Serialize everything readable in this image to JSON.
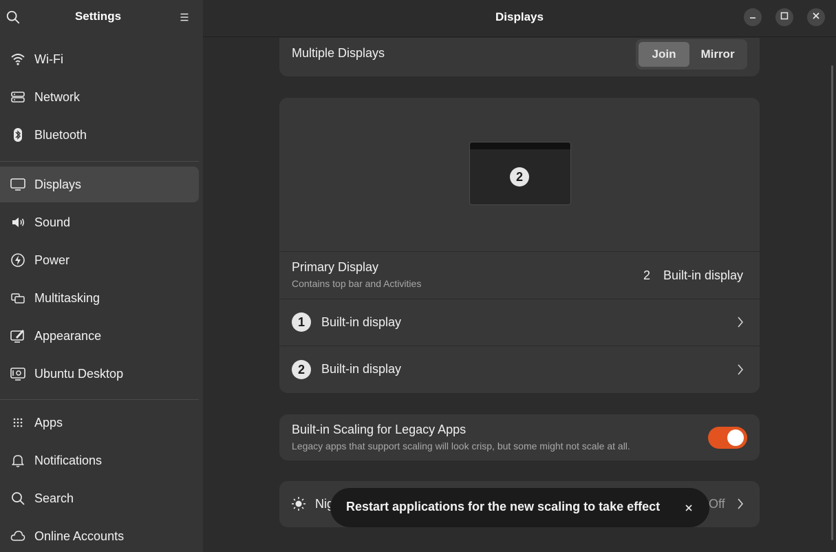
{
  "sidebar": {
    "title": "Settings",
    "items": [
      {
        "label": "Wi-Fi",
        "icon": "wifi-icon"
      },
      {
        "label": "Network",
        "icon": "network-icon"
      },
      {
        "label": "Bluetooth",
        "icon": "bluetooth-icon"
      },
      {
        "label": "Displays",
        "icon": "display-icon",
        "active": true
      },
      {
        "label": "Sound",
        "icon": "sound-icon"
      },
      {
        "label": "Power",
        "icon": "power-icon"
      },
      {
        "label": "Multitasking",
        "icon": "multitasking-icon"
      },
      {
        "label": "Appearance",
        "icon": "appearance-icon"
      },
      {
        "label": "Ubuntu Desktop",
        "icon": "ubuntu-desktop-icon"
      },
      {
        "label": "Apps",
        "icon": "apps-grid-icon"
      },
      {
        "label": "Notifications",
        "icon": "bell-icon"
      },
      {
        "label": "Search",
        "icon": "search-icon"
      },
      {
        "label": "Online Accounts",
        "icon": "cloud-icon"
      }
    ]
  },
  "main": {
    "title": "Displays",
    "multiple_displays": {
      "label": "Multiple Displays",
      "options": [
        "Join",
        "Mirror"
      ],
      "selected": "Join"
    },
    "arrangement": {
      "monitor_number": "2"
    },
    "primary_display": {
      "label": "Primary Display",
      "subtitle": "Contains top bar and Activities",
      "value_number": "2",
      "value_name": "Built-in display"
    },
    "displays": [
      {
        "number": "1",
        "name": "Built-in display"
      },
      {
        "number": "2",
        "name": "Built-in display"
      }
    ],
    "legacy_scaling": {
      "label": "Built-in Scaling for Legacy Apps",
      "subtitle": "Legacy apps that support scaling will look crisp, but some might not scale at all.",
      "enabled": true
    },
    "night_light": {
      "label_visible": "Nig",
      "status": "Off"
    }
  },
  "toast": {
    "message": "Restart applications for the new scaling to take effect"
  },
  "colors": {
    "accent": "#e2531f",
    "sidebar_bg": "#353535",
    "main_bg": "#2c2c2c",
    "card_bg": "#383838"
  }
}
